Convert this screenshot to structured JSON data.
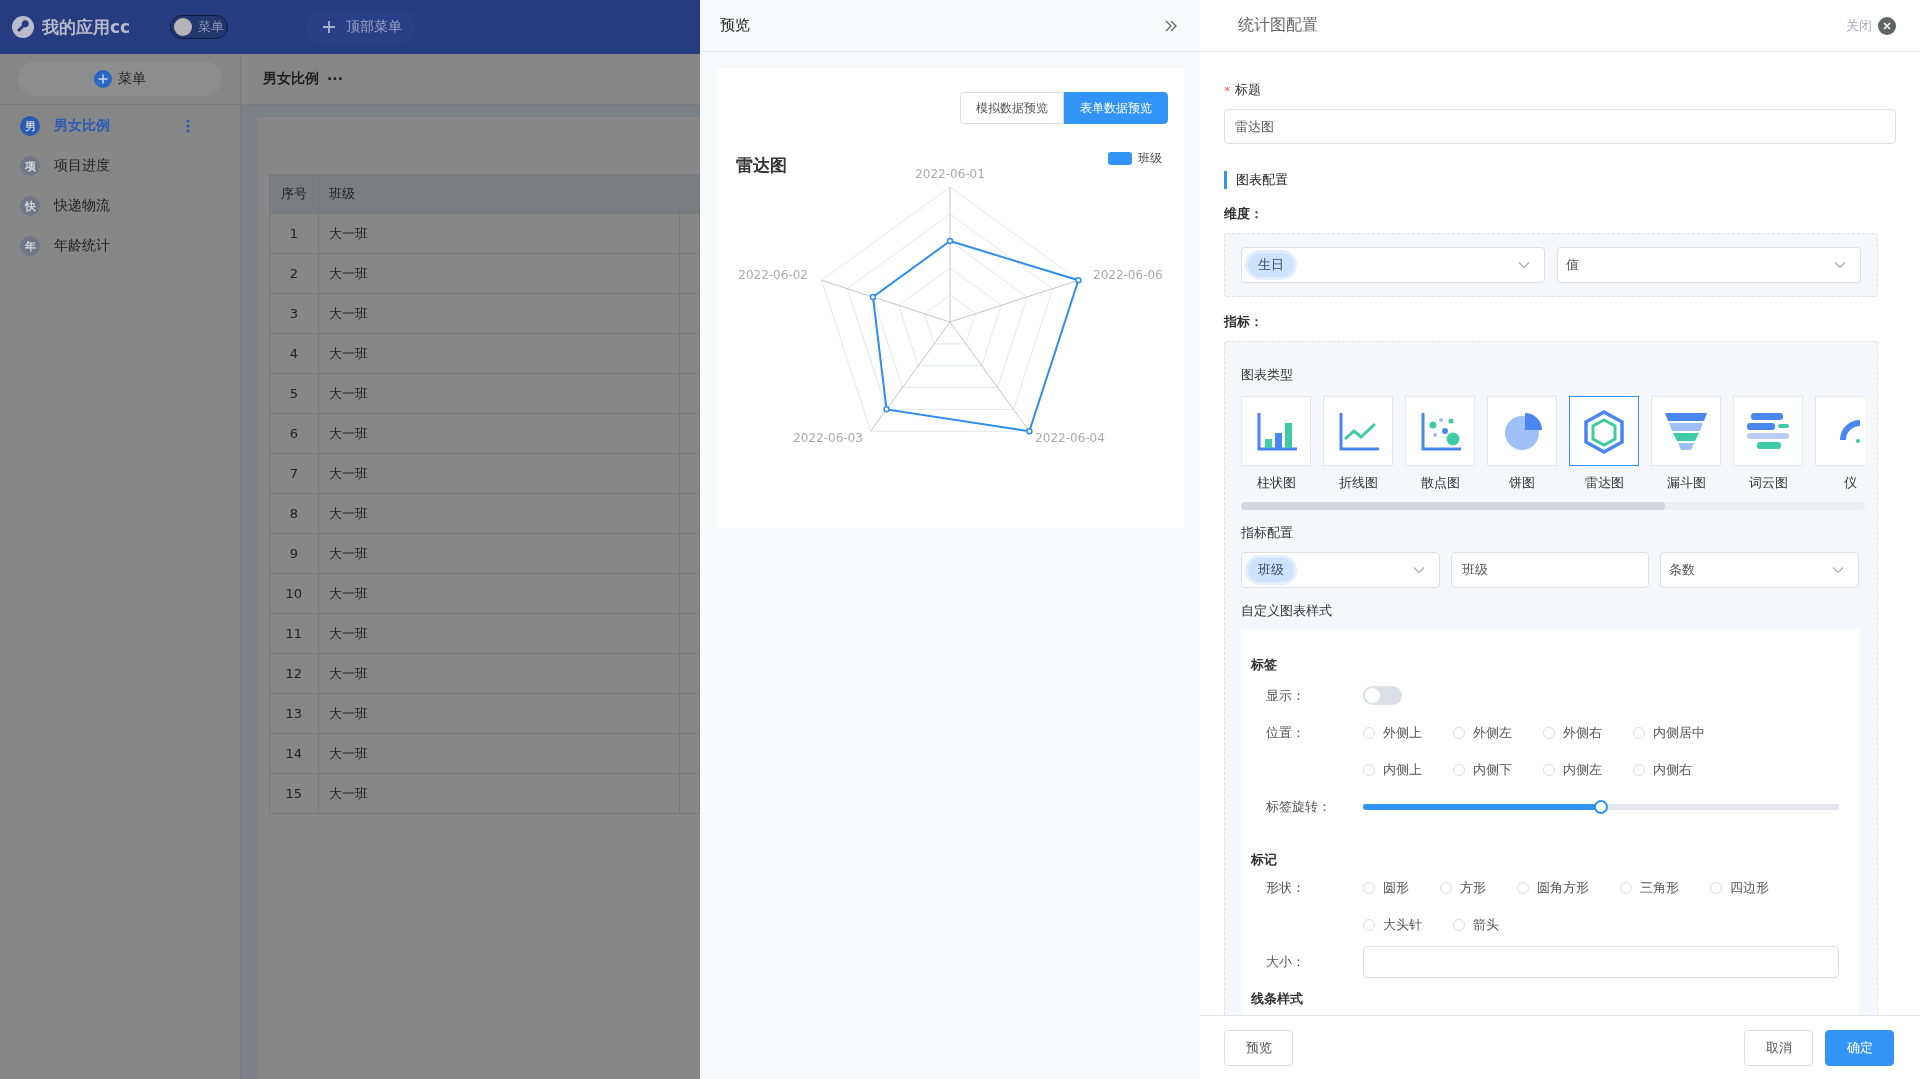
{
  "app": {
    "title": "我的应用cc",
    "menu_toggle": {
      "label": "菜单",
      "on": false
    },
    "top_menu_button": "顶部菜单"
  },
  "sidebar": {
    "add_button": "菜单",
    "items": [
      {
        "avatar": "男",
        "label": "男女比例",
        "selected": true
      },
      {
        "avatar": "项",
        "label": "项目进度",
        "selected": false
      },
      {
        "avatar": "快",
        "label": "快递物流",
        "selected": false
      },
      {
        "avatar": "年",
        "label": "年龄统计",
        "selected": false
      }
    ]
  },
  "page_tab": {
    "title": "男女比例",
    "more": "···"
  },
  "table": {
    "columns": [
      "序号",
      "班级"
    ],
    "rows": [
      [
        "1",
        "大一班"
      ],
      [
        "2",
        "大一班"
      ],
      [
        "3",
        "大一班"
      ],
      [
        "4",
        "大一班"
      ],
      [
        "5",
        "大一班"
      ],
      [
        "6",
        "大一班"
      ],
      [
        "7",
        "大一班"
      ],
      [
        "8",
        "大一班"
      ],
      [
        "9",
        "大一班"
      ],
      [
        "10",
        "大一班"
      ],
      [
        "11",
        "大一班"
      ],
      [
        "12",
        "大一班"
      ],
      [
        "13",
        "大一班"
      ],
      [
        "14",
        "大一班"
      ],
      [
        "15",
        "大一班"
      ]
    ]
  },
  "preview": {
    "title": "预览",
    "modes": [
      {
        "label": "模拟数据预览",
        "selected": false
      },
      {
        "label": "表单数据预览",
        "selected": true
      }
    ],
    "chart": {
      "title": "雷达图",
      "legend": "班级",
      "axes": [
        "2022-06-01",
        "2022-06-06",
        "2022-06-04",
        "2022-06-03",
        "2022-06-02"
      ]
    }
  },
  "config": {
    "title": "统计图配置",
    "close": "关闭",
    "title_field": {
      "required_mark": "*",
      "label": "标题",
      "value": "雷达图"
    },
    "section": "图表配置",
    "dimension": {
      "label": "维度：",
      "tag": "生日",
      "select": "值"
    },
    "metric": {
      "label": "指标：",
      "chart_type_label": "图表类型",
      "chart_types": [
        {
          "kind": "bar",
          "label": "柱状图",
          "selected": false
        },
        {
          "kind": "line",
          "label": "折线图",
          "selected": false
        },
        {
          "kind": "scatter",
          "label": "散点图",
          "selected": false
        },
        {
          "kind": "pie",
          "label": "饼图",
          "selected": false
        },
        {
          "kind": "radar",
          "label": "雷达图",
          "selected": true
        },
        {
          "kind": "funnel",
          "label": "漏斗图",
          "selected": false
        },
        {
          "kind": "wordcloud",
          "label": "词云图",
          "selected": false
        },
        {
          "kind": "gauge",
          "label": "仪",
          "selected": false
        }
      ],
      "config_label": "指标配置",
      "field_tag": "班级",
      "alias": "班级",
      "aggregate": "条数",
      "custom_style_label": "自定义图表样式",
      "label_group": {
        "title": "标签",
        "show_label": "显示：",
        "show": false,
        "position_label": "位置：",
        "positions": [
          [
            {
              "label": "外侧上",
              "selected": false
            },
            {
              "label": "外侧左",
              "selected": false
            },
            {
              "label": "外侧右",
              "selected": false
            },
            {
              "label": "内侧居中",
              "selected": false
            }
          ],
          [
            {
              "label": "内侧上",
              "selected": false
            },
            {
              "label": "内侧下",
              "selected": false
            },
            {
              "label": "内侧左",
              "selected": false
            },
            {
              "label": "内侧右",
              "selected": false
            }
          ]
        ],
        "rotation_label": "标签旋转：",
        "rotation": {
          "level": 0.5
        }
      },
      "marker_group": {
        "title": "标记",
        "shape_label": "形状：",
        "shapes": [
          [
            {
              "label": "圆形",
              "selected": false
            },
            {
              "label": "方形",
              "selected": false
            },
            {
              "label": "圆角方形",
              "selected": false
            },
            {
              "label": "三角形",
              "selected": false
            },
            {
              "label": "四边形",
              "selected": false
            }
          ],
          [
            {
              "label": "大头针",
              "selected": false
            },
            {
              "label": "箭头",
              "selected": false
            }
          ]
        ],
        "size_label": "大小："
      },
      "line_style_title": "线条样式"
    },
    "footer": {
      "preview": "预览",
      "cancel": "取消",
      "confirm": "确定"
    }
  }
}
